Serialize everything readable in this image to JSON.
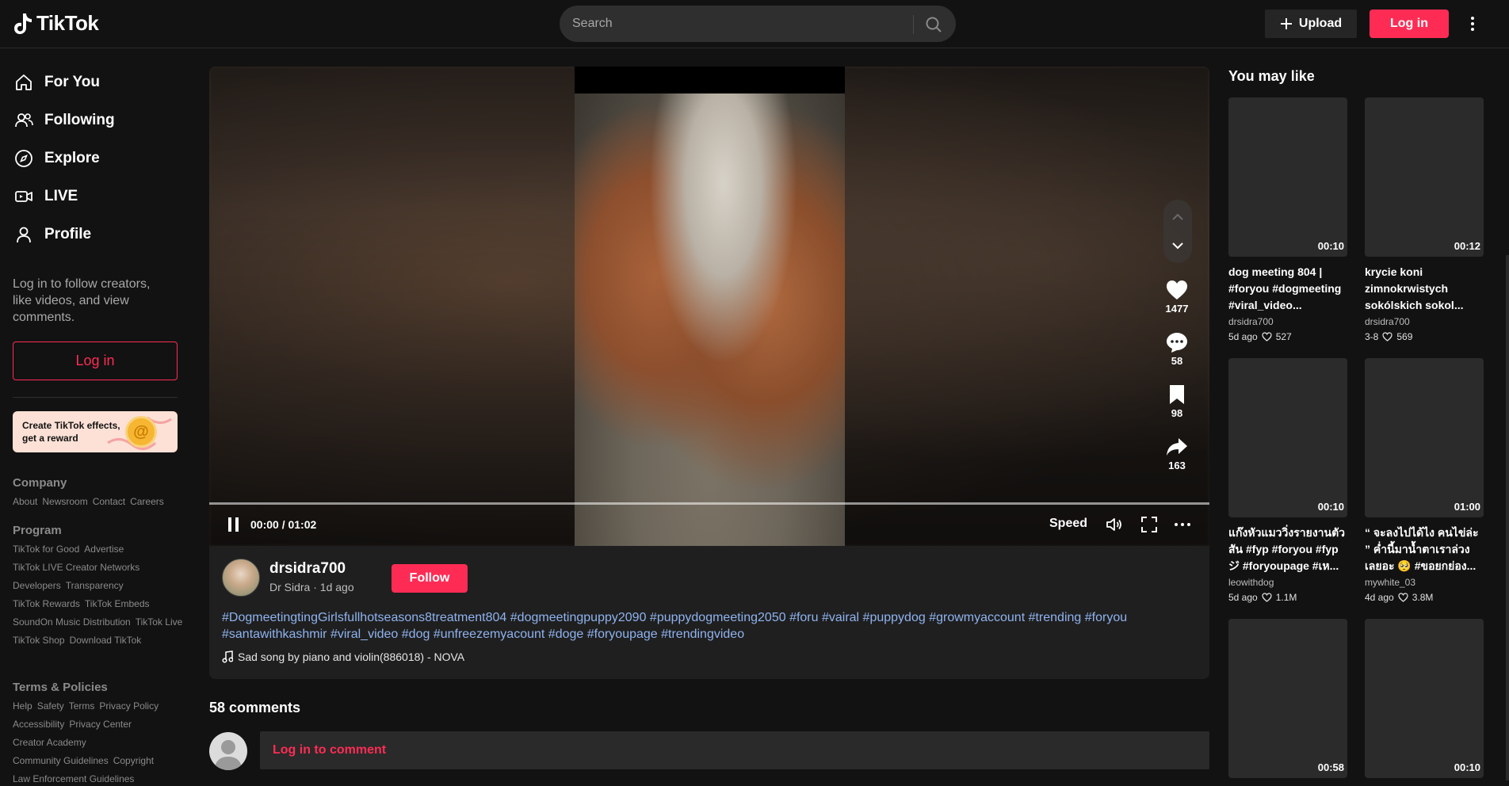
{
  "header": {
    "logo_text": "TikTok",
    "search_placeholder": "Search",
    "upload_label": "Upload",
    "login_label": "Log in"
  },
  "sidebar": {
    "nav": [
      {
        "label": "For You",
        "icon": "home-icon"
      },
      {
        "label": "Following",
        "icon": "following-icon"
      },
      {
        "label": "Explore",
        "icon": "compass-icon"
      },
      {
        "label": "LIVE",
        "icon": "live-icon"
      },
      {
        "label": "Profile",
        "icon": "profile-icon"
      }
    ],
    "login_note": "Log in to follow creators, like videos, and view comments.",
    "login_label": "Log in",
    "effects_text": "Create TikTok effects, get a reward",
    "company": {
      "title": "Company",
      "links": [
        "About",
        "Newsroom",
        "Contact",
        "Careers"
      ]
    },
    "program": {
      "title": "Program",
      "links": [
        "TikTok for Good",
        "Advertise",
        "TikTok LIVE Creator Networks",
        "Developers",
        "Transparency",
        "TikTok Rewards",
        "TikTok Embeds",
        "SoundOn Music Distribution",
        "TikTok Live",
        "TikTok Shop",
        "Download TikTok"
      ]
    },
    "terms": {
      "title": "Terms & Policies",
      "links": [
        "Help",
        "Safety",
        "Terms",
        "Privacy Policy",
        "Accessibility",
        "Privacy Center",
        "Creator Academy",
        "Community Guidelines",
        "Copyright",
        "Law Enforcement Guidelines"
      ]
    }
  },
  "video": {
    "likes": "1477",
    "comments": "58",
    "saves": "98",
    "shares": "163",
    "time": "00:00 / 01:02",
    "speed_label": "Speed"
  },
  "post": {
    "username": "drsidra700",
    "subline": "Dr Sidra · 1d ago",
    "follow_label": "Follow",
    "description": "#DogmeetingtingGirlsfullhotseasons8treatment804 #dogmeetingpuppy2090 #puppydogmeeting2050 #foru #vairal #puppydog #growmyaccount #trending #foryou #santawithkashmir #viral_video #dog #unfreezemyacount #doge #foryoupage #trendingvideo",
    "music": "Sad song by piano and violin(886018) - NOVA"
  },
  "comments": {
    "title": "58 comments",
    "login_prompt": "Log in to comment"
  },
  "recommendations": {
    "title": "You may like",
    "items": [
      {
        "duration": "00:10",
        "title": "dog meeting 804 | #foryou #dogmeeting #viral_video...",
        "author": "drsidra700",
        "date": "5d ago",
        "likes": "527"
      },
      {
        "duration": "00:12",
        "title": "krycie koni zimnokrwistych sokólskich sokol...",
        "author": "drsidra700",
        "date": "3-8",
        "likes": "569"
      },
      {
        "duration": "00:10",
        "title": "แก๊งหัวแมววิ่งรายงานตัว สัน #fyp #foryou #fypジ #foryoupage #เห...",
        "author": "leowithdog",
        "date": "5d ago",
        "likes": "1.1M"
      },
      {
        "duration": "01:00",
        "title": "“ จะลงไปได้ไง คนไข่ล่ะ ” ค่ำนี้มาน้ำตาเราล่วง เลยอะ 🥺 #ขอยกย่อง...",
        "author": "mywhite_03",
        "date": "4d ago",
        "likes": "3.8M"
      },
      {
        "duration": "00:58",
        "title": "",
        "author": "",
        "date": "",
        "likes": ""
      },
      {
        "duration": "00:10",
        "title": "",
        "author": "",
        "date": "",
        "likes": ""
      }
    ]
  },
  "colors": {
    "accent": "#fe2c55",
    "hashtag": "#8fb3ef",
    "background": "#121212"
  }
}
